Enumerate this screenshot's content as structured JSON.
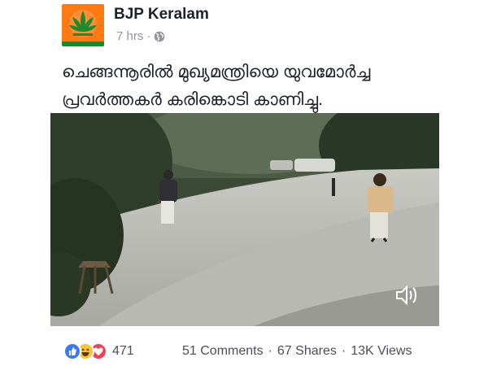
{
  "post": {
    "page_name": "BJP Keralam",
    "time": "7 hrs",
    "meta_separator": "·",
    "privacy_icon": "globe-icon",
    "text_line1": "ചെങ്ങന്നൂരിൽ മുഖ്യമന്ത്രിയെ യുവമോർച്ച",
    "text_line2": "പ്രവർത്തകർ കരിങ്കൊടി കാണിച്ചു."
  },
  "video": {
    "sound_icon": "speaker-icon"
  },
  "footer": {
    "reaction_icons": [
      "like-icon",
      "haha-icon",
      "love-icon"
    ],
    "reaction_count": "471",
    "comments": "51 Comments",
    "shares": "67 Shares",
    "views": "13K Views",
    "separator": "·"
  },
  "colors": {
    "avatar_bg": "#ff7a12",
    "like": "#3b7bf0",
    "haha": "#f8c43a",
    "love": "#f0415a",
    "meta_text": "#90949c"
  }
}
